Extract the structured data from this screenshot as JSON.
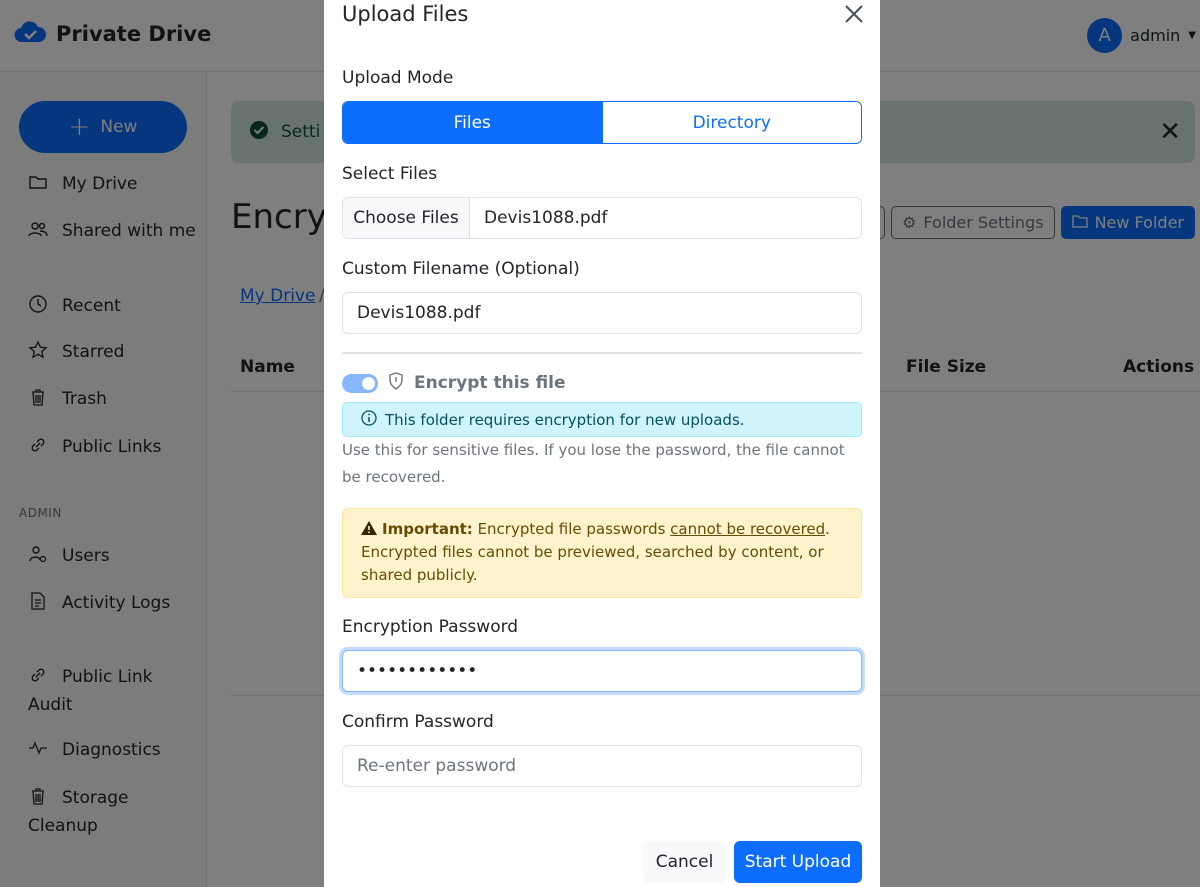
{
  "app": {
    "brand": "Private Drive",
    "user": {
      "initial": "A",
      "name": "admin"
    }
  },
  "sidebar": {
    "new_label": "New",
    "items": [
      {
        "label": "My Drive",
        "icon": "folder-icon"
      },
      {
        "label": "Shared with me",
        "icon": "people-icon"
      },
      {
        "label": "Recent",
        "icon": "clock-icon"
      },
      {
        "label": "Starred",
        "icon": "star-icon"
      },
      {
        "label": "Trash",
        "icon": "trash-icon"
      },
      {
        "label": "Public Links",
        "icon": "link-icon"
      }
    ],
    "admin_heading": "ADMIN",
    "admin_items": [
      {
        "label": "Users",
        "icon": "user-gear-icon"
      },
      {
        "label": "Activity Logs",
        "icon": "document-icon"
      },
      {
        "label": "Public Link Audit",
        "icon": "link-icon"
      },
      {
        "label": "Diagnostics",
        "icon": "pulse-icon"
      },
      {
        "label": "Storage Cleanup",
        "icon": "trash-icon"
      }
    ]
  },
  "main": {
    "alert_text": "Setti",
    "page_title": "Encryp",
    "toolbar": {
      "folder_settings": "Folder Settings",
      "new_folder": "New Folder"
    },
    "breadcrumb": {
      "root": "My Drive",
      "separator": "/"
    },
    "table_headers": {
      "name": "Name",
      "file_size": "File Size",
      "actions": "Actions"
    }
  },
  "modal": {
    "title": "Upload Files",
    "upload_mode_label": "Upload Mode",
    "mode_options": [
      "Files",
      "Directory"
    ],
    "selected_mode": "Files",
    "select_files_label": "Select Files",
    "choose_files_button": "Choose Files",
    "chosen_file": "Devis1088.pdf",
    "custom_filename_label": "Custom Filename (Optional)",
    "custom_filename_value": "Devis1088.pdf",
    "encrypt_toggle_label": "Encrypt this file",
    "encrypt_enabled": true,
    "info_text": "This folder requires encryption for new uploads.",
    "help_text": "Use this for sensitive files. If you lose the password, the file cannot be recovered.",
    "warning": {
      "strong": "Important:",
      "text_before": " Encrypted file passwords ",
      "underlined": "cannot be recovered",
      "text_after": ".",
      "line2": "Encrypted files cannot be previewed, searched by content, or shared publicly."
    },
    "encryption_password_label": "Encryption Password",
    "encryption_password_value": "••••••••••••",
    "confirm_password_label": "Confirm Password",
    "confirm_password_placeholder": "Re-enter password",
    "cancel_button": "Cancel",
    "start_upload_button": "Start Upload"
  },
  "colors": {
    "primary": "#0d6efd",
    "info_bg": "#cff4fc",
    "warning_bg": "#fff3cd",
    "success_bg": "#d1e7dd"
  }
}
